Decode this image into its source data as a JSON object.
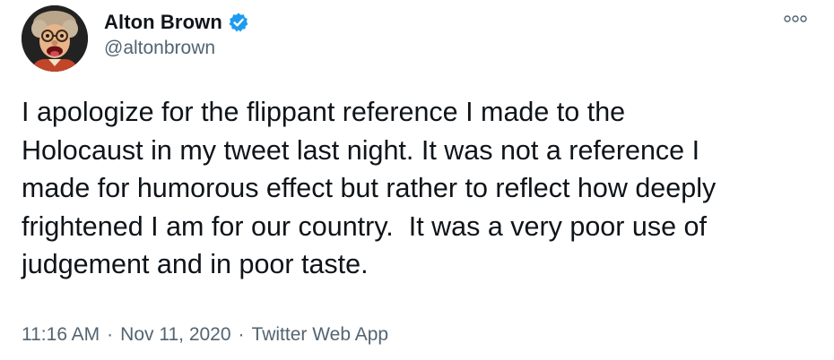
{
  "author": {
    "display_name": "Alton Brown",
    "handle": "@altonbrown",
    "verified": true,
    "verified_icon": "verified-badge-icon",
    "avatar_icon": "puppet-avatar"
  },
  "tweet": {
    "text": "I apologize for the flippant reference I made to the\nHolocaust in my tweet last night. It was not a reference I\nmade for humorous effect but rather to reflect how deeply\nfrightened I am for our country.  It was a very poor use of\njudgement and in poor taste."
  },
  "meta": {
    "time": "11:16 AM",
    "separator": "·",
    "date": "Nov 11, 2020",
    "source": "Twitter Web App"
  },
  "menu": {
    "icon": "more-options-icon"
  },
  "colors": {
    "text": "#0f1419",
    "secondary": "#536471",
    "verified": "#1d9bf0"
  }
}
